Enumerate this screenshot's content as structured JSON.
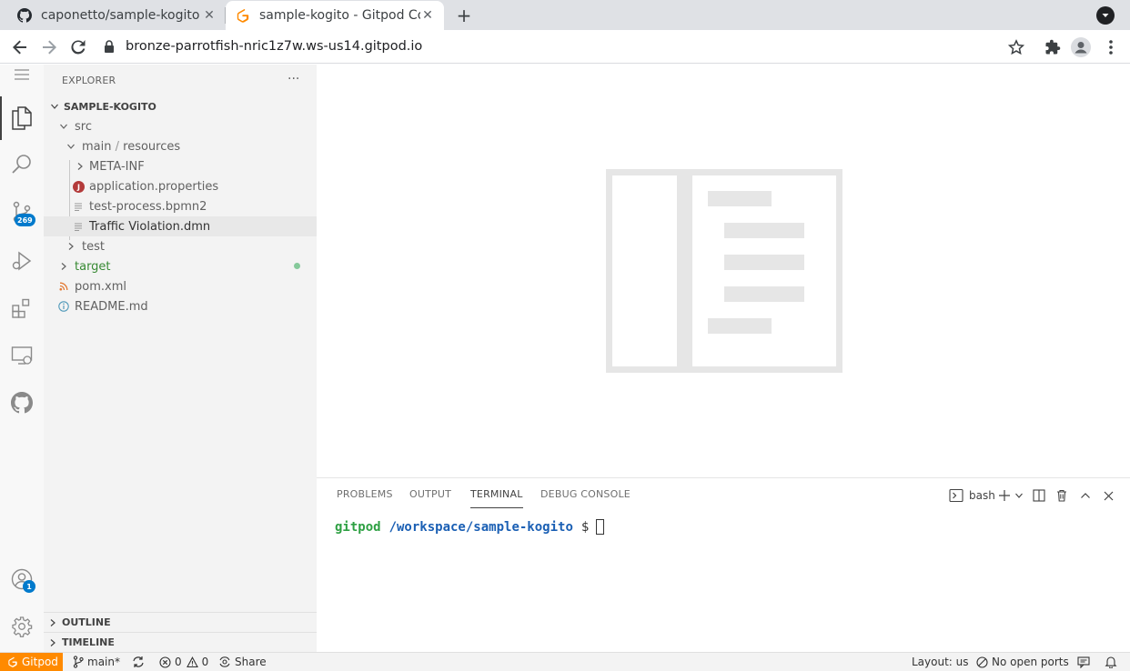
{
  "browser": {
    "tabs": [
      {
        "title": "caponetto/sample-kogito",
        "favicon": "github-icon"
      },
      {
        "title": "sample-kogito - Gitpod Co",
        "favicon": "gitpod-icon"
      }
    ],
    "url": "bronze-parrotfish-nric1z7w.ws-us14.gitpod.io"
  },
  "activity_bar": {
    "scm_badge": "269",
    "accounts_badge": "1"
  },
  "explorer": {
    "header": "EXPLORER",
    "more": "···",
    "project": "SAMPLE-KOGITO",
    "tree": [
      {
        "label": "src",
        "color": "#616161"
      },
      {
        "label": "main",
        "sep": " / ",
        "label2": "resources",
        "color": "#616161"
      },
      {
        "label": "META-INF",
        "color": "#616161"
      },
      {
        "label": "application.properties",
        "color": "#616161",
        "icon_letter": "J"
      },
      {
        "label": "test-process.bpmn2",
        "color": "#616161"
      },
      {
        "label": "Traffic Violation.dmn",
        "color": "#333333"
      },
      {
        "label": "test",
        "color": "#616161"
      },
      {
        "label": "target",
        "color": "#388a34"
      },
      {
        "label": "pom.xml",
        "color": "#616161"
      },
      {
        "label": "README.md",
        "color": "#616161"
      }
    ],
    "outline": "OUTLINE",
    "timeline": "TIMELINE"
  },
  "panel": {
    "tabs": [
      "PROBLEMS",
      "OUTPUT",
      "TERMINAL",
      "DEBUG CONSOLE"
    ],
    "active_tab": "TERMINAL",
    "shell": "bash",
    "terminal": {
      "user": "gitpod",
      "path": "/workspace/sample-kogito",
      "prompt": "$"
    }
  },
  "status_bar": {
    "gitpod": "Gitpod",
    "branch": "main*",
    "errors": "0",
    "warnings": "0",
    "share": "Share",
    "layout": "Layout: us",
    "ports": "No open ports"
  },
  "colors": {
    "gitpod_orange": "#ff8a00",
    "terminal_user": "#2ea043",
    "terminal_path": "#1a5fb4",
    "badge_blue": "#007acc"
  }
}
